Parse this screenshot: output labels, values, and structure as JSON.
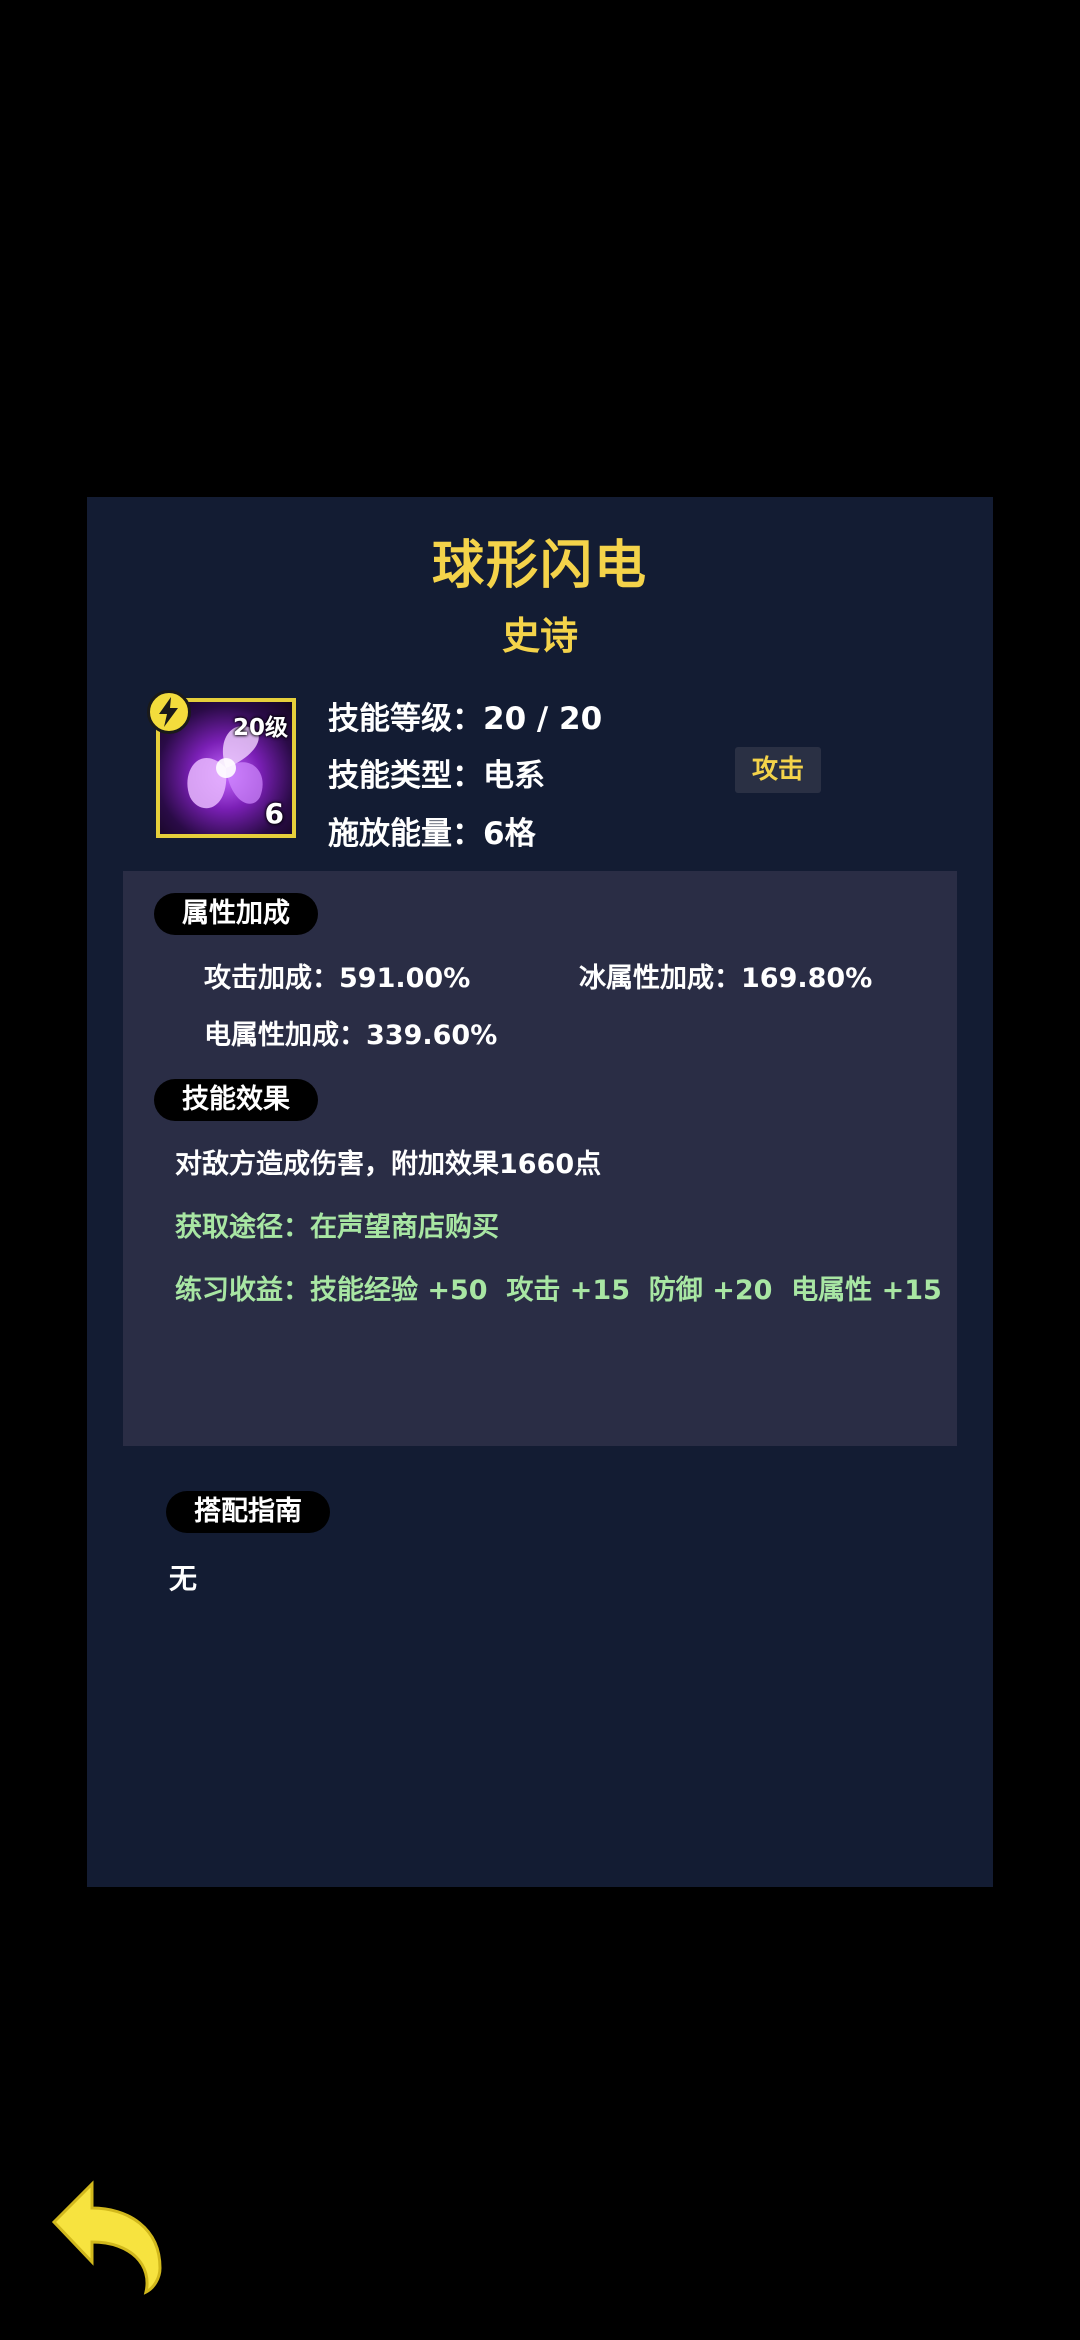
{
  "skill": {
    "name": "球形闪电",
    "rarity": "史诗",
    "icon": "purple-swirl-icon",
    "level_tag": "20级",
    "cost_tag": "6",
    "element_badge": "lightning-bolt-icon",
    "info": {
      "level": "技能等级：20 / 20",
      "type": "技能类型：电系",
      "energy": "施放能量：6格"
    },
    "type_tag": "攻击"
  },
  "attributes": {
    "header": "属性加成",
    "items": [
      "攻击加成：591.00%",
      "冰属性加成：169.80%",
      "电属性加成：339.60%"
    ]
  },
  "effect": {
    "header": "技能效果",
    "description": "对敌方造成伤害，附加效果1660点",
    "source": "获取途径：在声望商店购买",
    "practice": "练习收益：技能经验 +50  攻击 +15  防御 +20  电属性 +15"
  },
  "guide": {
    "header": "搭配指南",
    "text": "无"
  },
  "nav": {
    "back_icon": "back-arrow-icon"
  },
  "colors": {
    "title": "#f4d34a",
    "panel": "#131c33",
    "subpanel": "#2a2d45",
    "green_text": "#a8e6a3",
    "icon_border": "#e6cf3b"
  }
}
